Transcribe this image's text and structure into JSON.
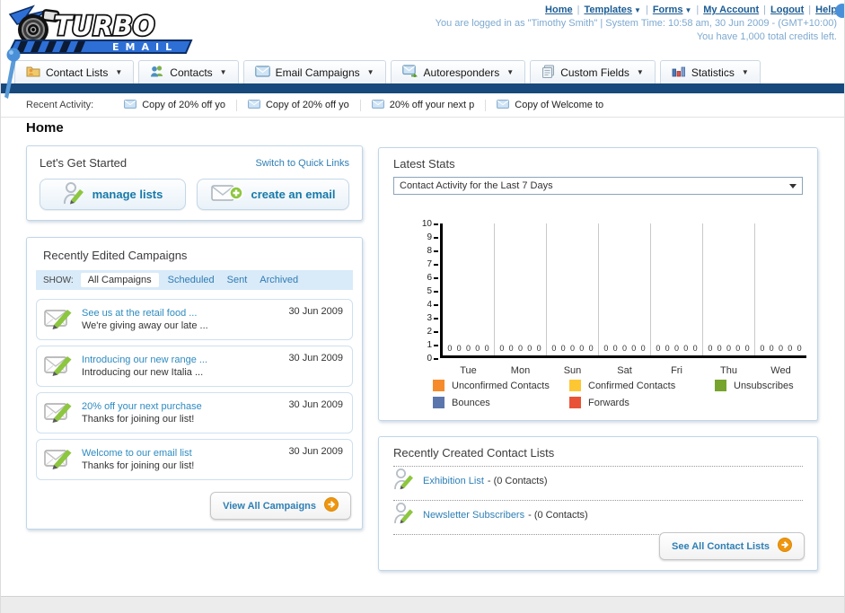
{
  "header": {
    "top_links": [
      {
        "label": "Home",
        "dropdown": false
      },
      {
        "label": "Templates",
        "dropdown": true
      },
      {
        "label": "Forms",
        "dropdown": true
      },
      {
        "label": "My Account",
        "dropdown": false
      },
      {
        "label": "Logout",
        "dropdown": false
      },
      {
        "label": "Help",
        "dropdown": false
      }
    ],
    "login_line1": "You are logged in as \"Timothy Smith\" | System Time: 10:58 am, 30 Jun 2009 - (GMT+10:00)",
    "login_line2": "You have 1,000 total credits left.",
    "logo_title": "TURBO",
    "logo_subtitle": "EMAIL"
  },
  "nav": {
    "tabs": [
      {
        "label": "Contact Lists",
        "icon": "contact-lists-icon"
      },
      {
        "label": "Contacts",
        "icon": "contacts-icon"
      },
      {
        "label": "Email Campaigns",
        "icon": "email-campaigns-icon"
      },
      {
        "label": "Autoresponders",
        "icon": "autoresponders-icon"
      },
      {
        "label": "Custom Fields",
        "icon": "custom-fields-icon"
      },
      {
        "label": "Statistics",
        "icon": "statistics-icon"
      }
    ]
  },
  "recent_activity": {
    "label": "Recent Activity:",
    "items": [
      "Copy of 20% off yo",
      "Copy of 20% off yo",
      "20% off your next p",
      "Copy of Welcome to"
    ]
  },
  "page": {
    "title": "Home"
  },
  "get_started": {
    "title": "Let's Get Started",
    "switch_link": "Switch to Quick Links",
    "manage_lists_label": "manage lists",
    "create_email_label": "create an email"
  },
  "campaigns": {
    "title": "Recently Edited Campaigns",
    "show_label": "SHOW:",
    "filters": [
      {
        "label": "All Campaigns",
        "active": true
      },
      {
        "label": "Scheduled",
        "active": false
      },
      {
        "label": "Sent",
        "active": false
      },
      {
        "label": "Archived",
        "active": false
      }
    ],
    "items": [
      {
        "title": "See us at the retail food ...",
        "subtitle": "We're giving away our late ...",
        "date": "30 Jun 2009"
      },
      {
        "title": "Introducing our new range ...",
        "subtitle": "Introducing our new Italia ...",
        "date": "30 Jun 2009"
      },
      {
        "title": "20% off your next purchase",
        "subtitle": "Thanks for joining our list!",
        "date": "30 Jun 2009"
      },
      {
        "title": "Welcome to our email list",
        "subtitle": "Thanks for joining our list!",
        "date": "30 Jun 2009"
      }
    ],
    "view_all_label": "View All Campaigns"
  },
  "stats": {
    "title": "Latest Stats",
    "selected_report": "Contact Activity for the Last 7 Days"
  },
  "chart_data": {
    "type": "bar",
    "title": "Contact Activity for the Last 7 Days",
    "categories": [
      "Tue",
      "Mon",
      "Sun",
      "Sat",
      "Fri",
      "Thu",
      "Wed"
    ],
    "series": [
      {
        "name": "Unconfirmed Contacts",
        "color": "#f68b2c",
        "values": [
          0,
          0,
          0,
          0,
          0,
          0,
          0
        ]
      },
      {
        "name": "Confirmed Contacts",
        "color": "#fdc734",
        "values": [
          0,
          0,
          0,
          0,
          0,
          0,
          0
        ]
      },
      {
        "name": "Unsubscribes",
        "color": "#76a42d",
        "values": [
          0,
          0,
          0,
          0,
          0,
          0,
          0
        ]
      },
      {
        "name": "Bounces",
        "color": "#5b76ad",
        "values": [
          0,
          0,
          0,
          0,
          0,
          0,
          0
        ]
      },
      {
        "name": "Forwards",
        "color": "#e85338",
        "values": [
          0,
          0,
          0,
          0,
          0,
          0,
          0
        ]
      }
    ],
    "ylim": [
      0,
      10
    ],
    "yticks": [
      0,
      1,
      2,
      3,
      4,
      5,
      6,
      7,
      8,
      9,
      10
    ],
    "grid": true,
    "legend_position": "bottom"
  },
  "contact_lists": {
    "title": "Recently Created Contact Lists",
    "items": [
      {
        "name": "Exhibition List",
        "suffix": "- (0 Contacts)"
      },
      {
        "name": "Newsletter Subscribers",
        "suffix": "- (0 Contacts)"
      }
    ],
    "see_all_label": "See All Contact Lists"
  },
  "colors": {
    "navy_bar": "#17497c",
    "link_blue": "#2e7fb5",
    "button_text_blue": "#1779a8",
    "orange_arrow": "#f0950f"
  }
}
